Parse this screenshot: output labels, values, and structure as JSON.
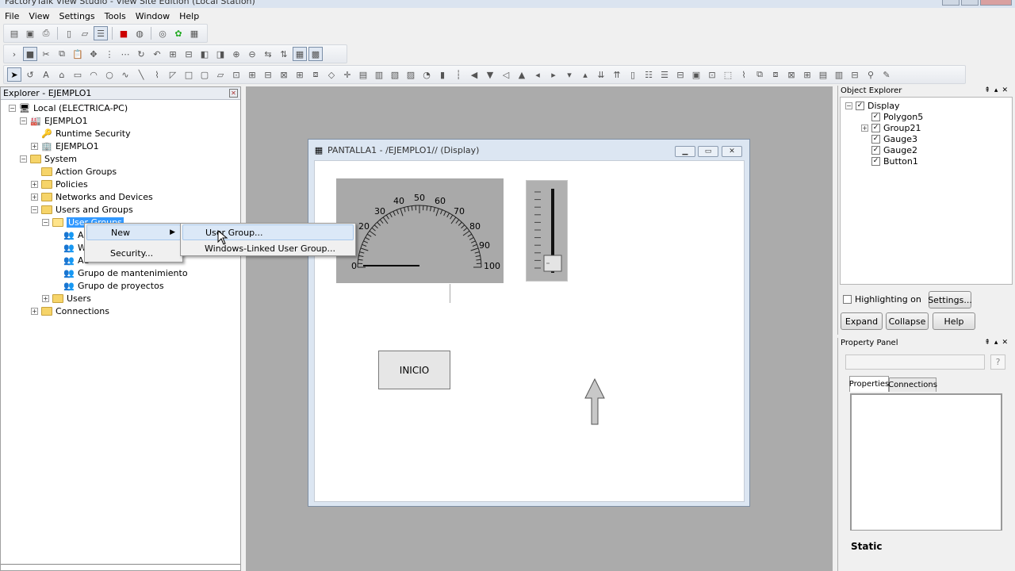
{
  "app": {
    "title": "FactoryTalk View Studio - View Site Edition (Local Station)"
  },
  "menubar": [
    "File",
    "View",
    "Settings",
    "Tools",
    "Window",
    "Help"
  ],
  "explorer": {
    "title": "Explorer - EJEMPLO1",
    "tree": {
      "local": "Local (ELECTRICA-PC)",
      "app": "EJEMPLO1",
      "runtime_security": "Runtime Security",
      "app_child": "EJEMPLO1",
      "system": "System",
      "action_groups": "Action Groups",
      "policies": "Policies",
      "networks": "Networks and Devices",
      "users_groups": "Users and Groups",
      "user_groups": "User Groups",
      "group1": "Au",
      "group2": "Wi",
      "group3": "Ad",
      "group4": "Grupo de mantenimiento",
      "group5": "Grupo de proyectos",
      "users": "Users",
      "connections": "Connections"
    }
  },
  "context_menu": {
    "new": "New",
    "security": "Security...",
    "submenu": {
      "user_group": "User Group...",
      "windows_linked": "Windows-Linked User Group..."
    }
  },
  "display_window": {
    "title": "PANTALLA1 - /EJEMPLO1// (Display)",
    "gauge": {
      "ticks": [
        "0",
        "20",
        "30",
        "40",
        "50",
        "60",
        "70",
        "80",
        "90",
        "100"
      ]
    },
    "button": "INICIO"
  },
  "object_explorer": {
    "title": "Object Explorer",
    "items": [
      "Display",
      "Polygon5",
      "Group21",
      "Gauge3",
      "Gauge2",
      "Button1"
    ],
    "highlight_label": "Highlighting on",
    "settings": "Settings...",
    "expand": "Expand",
    "collapse": "Collapse",
    "help": "Help"
  },
  "property_panel": {
    "title": "Property Panel",
    "tab_properties": "Properties",
    "tab_connections": "Connections",
    "help_icon": "?",
    "section": "Static"
  },
  "colors": {
    "selection": "#3399ff",
    "mdi_background": "#ababab",
    "gauge_face": "#a9a9a9"
  }
}
